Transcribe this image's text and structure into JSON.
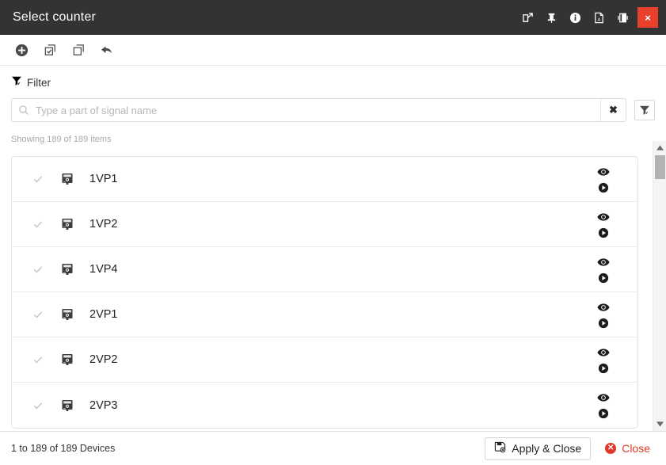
{
  "titlebar": {
    "title": "Select counter",
    "icons": [
      {
        "name": "popout-icon",
        "label": "Open in new window"
      },
      {
        "name": "pin-icon",
        "label": "Pin"
      },
      {
        "name": "info-icon",
        "label": "Info"
      },
      {
        "name": "pdf-icon",
        "label": "Export PDF"
      },
      {
        "name": "dock-split-icon",
        "label": "Dock"
      }
    ],
    "close_label": "×"
  },
  "toolbar": {
    "items": [
      {
        "name": "add-icon",
        "label": "Add"
      },
      {
        "name": "select-all-icon",
        "label": "Select all"
      },
      {
        "name": "copy-icon",
        "label": "Copy"
      },
      {
        "name": "undo-icon",
        "label": "Undo"
      }
    ]
  },
  "filter": {
    "label": "Filter",
    "placeholder": "Type a part of signal name",
    "value": "",
    "clear_label": "✖",
    "settings_label": "Filter settings"
  },
  "list": {
    "showing_text": "Showing 189 of 189 items",
    "rows": [
      {
        "label": "1VP1",
        "checked": true
      },
      {
        "label": "1VP2",
        "checked": true
      },
      {
        "label": "1VP4",
        "checked": true
      },
      {
        "label": "2VP1",
        "checked": true
      },
      {
        "label": "2VP2",
        "checked": true
      },
      {
        "label": "2VP3",
        "checked": true
      }
    ],
    "row_actions": [
      {
        "name": "eye-icon",
        "label": "View"
      },
      {
        "name": "play-icon",
        "label": "Run"
      }
    ]
  },
  "footer": {
    "status": "1 to 189 of 189 Devices",
    "apply_label": "Apply & Close",
    "close_label": "Close"
  },
  "colors": {
    "titlebar_bg": "#333333",
    "close_red": "#e8402a",
    "check_green": "#bfd3c3",
    "link_red": "#e03a28"
  }
}
